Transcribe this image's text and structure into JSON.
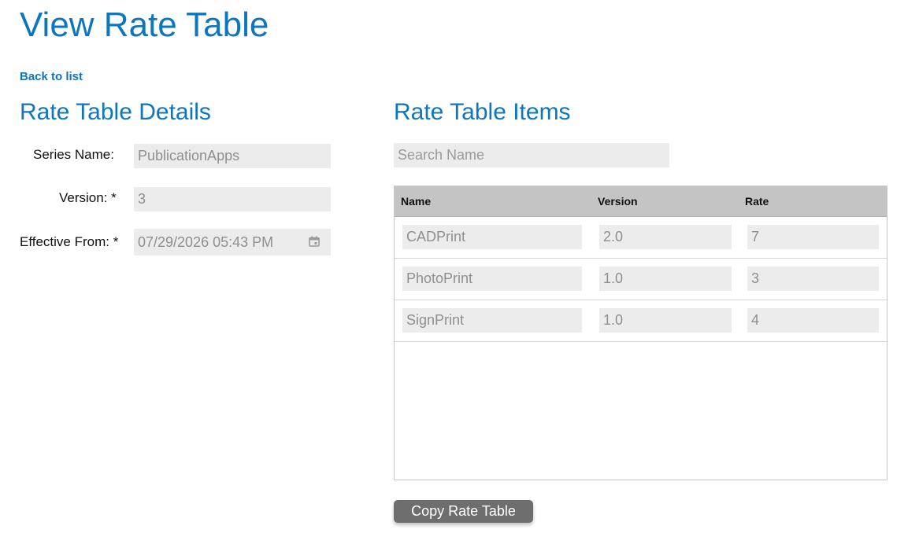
{
  "page": {
    "title": "View Rate Table",
    "back_link": "Back to list"
  },
  "details": {
    "title": "Rate Table Details",
    "series_name": {
      "label": "Series Name:",
      "value": "PublicationApps"
    },
    "version": {
      "label": "Version: *",
      "value": "3"
    },
    "effective_from": {
      "label": "Effective From: *",
      "value": "07/29/2026 05:43 PM",
      "icon": "calendar-icon"
    }
  },
  "items": {
    "title": "Rate Table Items",
    "search_placeholder": "Search Name",
    "columns": [
      "Name",
      "Version",
      "Rate"
    ],
    "rows": [
      {
        "name": "CADPrint",
        "version": "2.0",
        "rate": "7"
      },
      {
        "name": "PhotoPrint",
        "version": "1.0",
        "rate": "3"
      },
      {
        "name": "SignPrint",
        "version": "1.0",
        "rate": "4"
      }
    ]
  },
  "actions": {
    "copy_label": "Copy Rate Table"
  },
  "colors": {
    "accent": "#0d76bd",
    "field_bg": "#ececec",
    "header_bg": "#c4c4c4",
    "button_bg": "#6e6e6e"
  }
}
